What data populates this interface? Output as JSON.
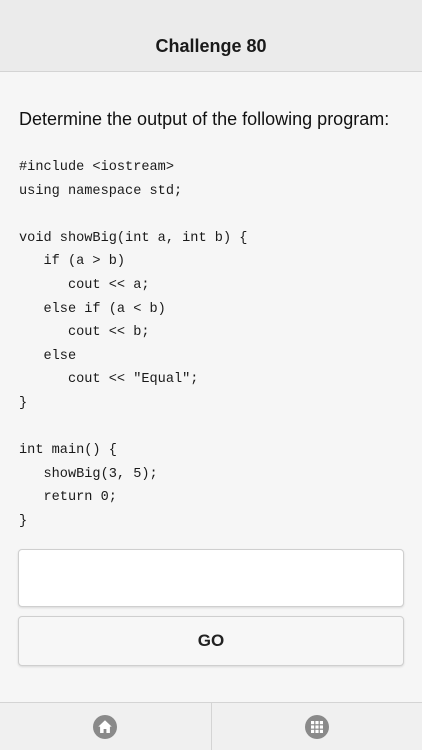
{
  "header": {
    "title": "Challenge 80"
  },
  "question": {
    "prompt": "Determine the output of the following program:"
  },
  "code": {
    "lines": [
      "#include <iostream>",
      "using namespace std;",
      "",
      "void showBig(int a, int b) {",
      "   if (a > b)",
      "      cout << a;",
      "   else if (a < b)",
      "      cout << b;",
      "   else",
      "      cout << \"Equal\";",
      "}",
      "",
      "int main() {",
      "   showBig(3, 5);",
      "   return 0;",
      "}"
    ]
  },
  "answer": {
    "value": "",
    "placeholder": ""
  },
  "actions": {
    "go_label": "GO"
  },
  "tabbar": {
    "items": [
      {
        "icon": "home-icon"
      },
      {
        "icon": "grid-icon"
      }
    ]
  },
  "colors": {
    "icon": "#8a8a8a",
    "navbar": "#ebebeb",
    "background": "#f6f6f6"
  }
}
